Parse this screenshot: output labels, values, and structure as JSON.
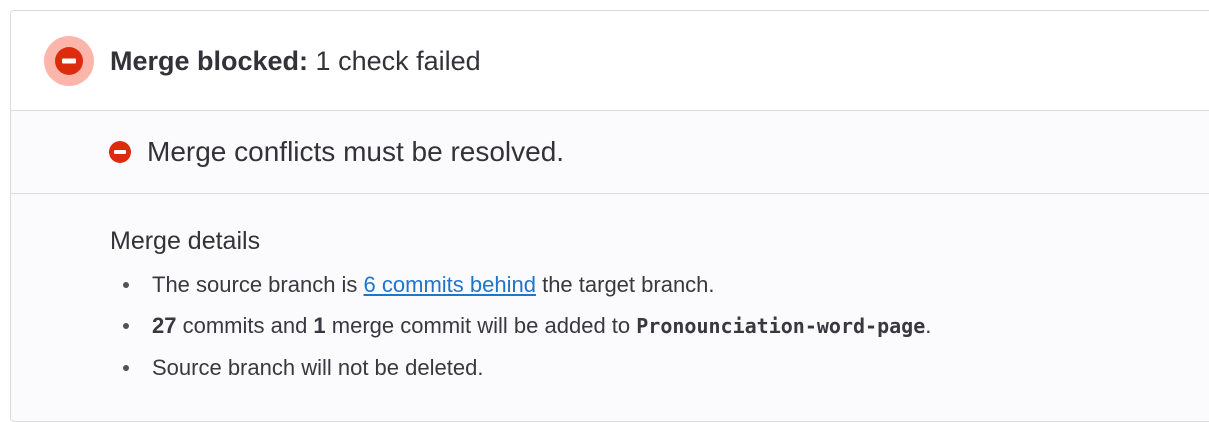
{
  "header": {
    "status_icon": "minus-circle-icon",
    "title_bold": "Merge blocked:",
    "title_rest": " 1 check failed"
  },
  "checks": [
    {
      "icon": "minus-circle-icon",
      "text": "Merge conflicts must be resolved."
    }
  ],
  "details": {
    "title": "Merge details",
    "behind": {
      "prefix": "The source branch is ",
      "link": "6 commits behind",
      "suffix": " the target branch."
    },
    "commits": {
      "count": "27",
      "middle": " commits and ",
      "merge_count": "1",
      "after": " merge commit will be added to ",
      "branch": "Pronounciation-word-page",
      "end": "."
    },
    "delete_note": "Source branch will not be deleted."
  },
  "colors": {
    "danger": "#dd2b0e",
    "danger_halo": "#fcb5aa",
    "link": "#1f75cb"
  }
}
